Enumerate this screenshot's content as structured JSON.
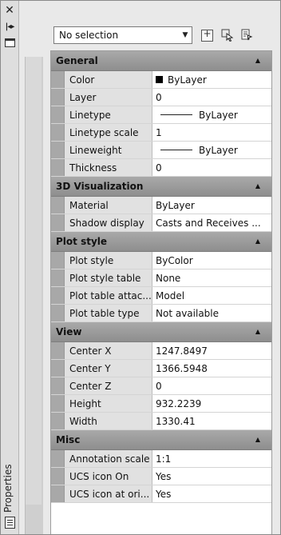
{
  "palette": {
    "title": "Properties",
    "selection": "No selection"
  },
  "categories": [
    {
      "name": "General",
      "rows": [
        {
          "label": "Color",
          "value": "ByLayer",
          "swatch": "#000000"
        },
        {
          "label": "Layer",
          "value": "0"
        },
        {
          "label": "Linetype",
          "value": "ByLayer",
          "line": true
        },
        {
          "label": "Linetype scale",
          "value": "1"
        },
        {
          "label": "Lineweight",
          "value": "ByLayer",
          "line": true
        },
        {
          "label": "Thickness",
          "value": "0"
        }
      ]
    },
    {
      "name": "3D Visualization",
      "rows": [
        {
          "label": "Material",
          "value": "ByLayer"
        },
        {
          "label": "Shadow display",
          "value": "Casts and Receives ..."
        }
      ]
    },
    {
      "name": "Plot style",
      "rows": [
        {
          "label": "Plot style",
          "value": "ByColor"
        },
        {
          "label": "Plot style table",
          "value": "None"
        },
        {
          "label": "Plot table attac...",
          "value": "Model"
        },
        {
          "label": "Plot table type",
          "value": "Not available"
        }
      ]
    },
    {
      "name": "View",
      "rows": [
        {
          "label": "Center X",
          "value": "1247.8497"
        },
        {
          "label": "Center Y",
          "value": "1366.5948"
        },
        {
          "label": "Center Z",
          "value": "0"
        },
        {
          "label": "Height",
          "value": "932.2239"
        },
        {
          "label": "Width",
          "value": "1330.41"
        }
      ]
    },
    {
      "name": "Misc",
      "rows": [
        {
          "label": "Annotation scale",
          "value": "1:1"
        },
        {
          "label": "UCS icon On",
          "value": "Yes"
        },
        {
          "label": "UCS icon at ori...",
          "value": "Yes"
        }
      ]
    }
  ],
  "icons": {
    "close": "close-icon",
    "autohide": "autohide-icon",
    "menu": "properties-menu-icon",
    "pickadd": "pickadd-icon",
    "select": "select-objects-icon",
    "quickselect": "quick-select-icon",
    "collapse": "collapse-arrow-icon"
  }
}
